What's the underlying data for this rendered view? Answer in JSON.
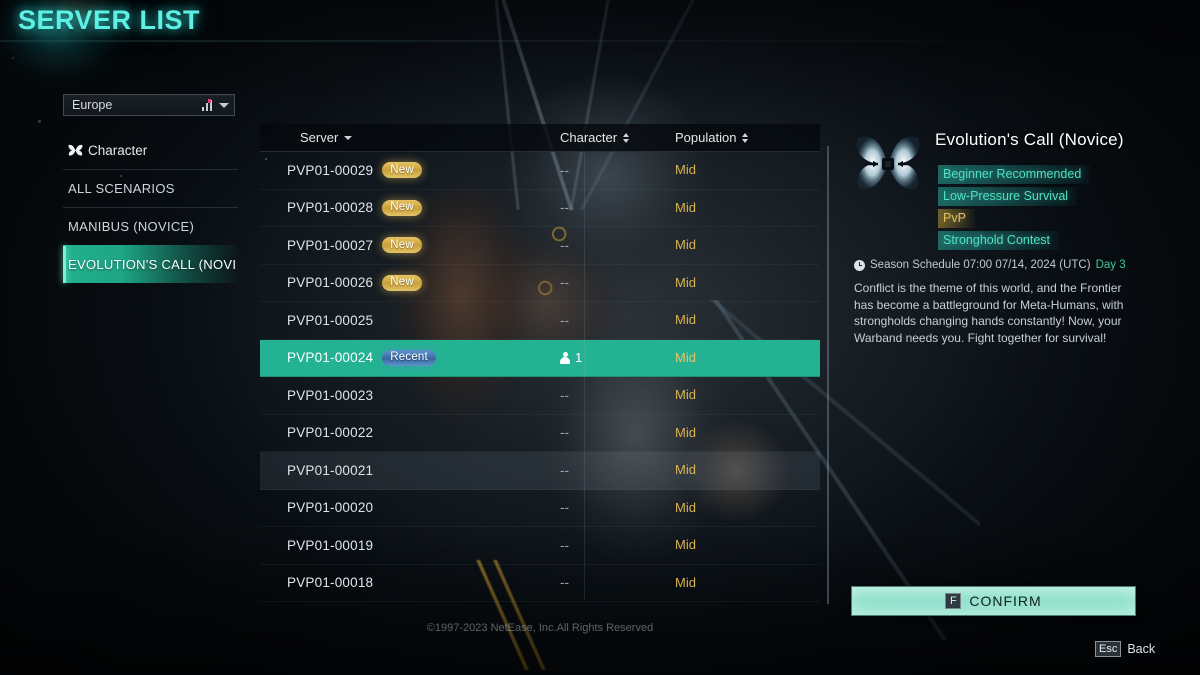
{
  "page_title": "SERVER LIST",
  "region_select": {
    "name": "region-dropdown",
    "value": "Europe",
    "signal_icon": "signal-bars-icon",
    "chevron_icon": "chevron-down-icon"
  },
  "sidebar": {
    "items": [
      {
        "label": "Character",
        "icon": "moth-emblem-icon",
        "selected": false,
        "has_icon": true
      },
      {
        "label": "ALL SCENARIOS",
        "selected": false,
        "has_icon": false
      },
      {
        "label": "MANIBUS (NOVICE)",
        "selected": false,
        "has_icon": false
      },
      {
        "label": "EVOLUTION'S CALL (NOVI",
        "selected": true,
        "has_icon": false
      }
    ]
  },
  "table": {
    "headers": {
      "server": "Server",
      "character": "Character",
      "population": "Population",
      "server_sort_icon": "chevron-down-icon",
      "character_sort_icon": "sort-updown-icon",
      "population_sort_icon": "sort-updown-icon"
    },
    "rows": [
      {
        "server": "PVP01-00029",
        "badge": "New",
        "badge_type": "new",
        "character": "--",
        "population": "Mid",
        "state": "normal"
      },
      {
        "server": "PVP01-00028",
        "badge": "New",
        "badge_type": "new",
        "character": "--",
        "population": "Mid",
        "state": "normal"
      },
      {
        "server": "PVP01-00027",
        "badge": "New",
        "badge_type": "new",
        "character": "--",
        "population": "Mid",
        "state": "normal"
      },
      {
        "server": "PVP01-00026",
        "badge": "New",
        "badge_type": "new",
        "character": "--",
        "population": "Mid",
        "state": "normal"
      },
      {
        "server": "PVP01-00025",
        "badge": "",
        "badge_type": "",
        "character": "--",
        "population": "Mid",
        "state": "normal"
      },
      {
        "server": "PVP01-00024",
        "badge": "Recent",
        "badge_type": "recent",
        "character": "1",
        "population": "Mid",
        "state": "selected"
      },
      {
        "server": "PVP01-00023",
        "badge": "",
        "badge_type": "",
        "character": "--",
        "population": "Mid",
        "state": "normal"
      },
      {
        "server": "PVP01-00022",
        "badge": "",
        "badge_type": "",
        "character": "--",
        "population": "Mid",
        "state": "normal"
      },
      {
        "server": "PVP01-00021",
        "badge": "",
        "badge_type": "",
        "character": "--",
        "population": "Mid",
        "state": "hovered"
      },
      {
        "server": "PVP01-00020",
        "badge": "",
        "badge_type": "",
        "character": "--",
        "population": "Mid",
        "state": "normal"
      },
      {
        "server": "PVP01-00019",
        "badge": "",
        "badge_type": "",
        "character": "--",
        "population": "Mid",
        "state": "normal"
      },
      {
        "server": "PVP01-00018",
        "badge": "",
        "badge_type": "",
        "character": "--",
        "population": "Mid",
        "state": "normal"
      }
    ]
  },
  "copyright": "©1997-2023 NetEase, Inc.All Rights Reserved",
  "detail": {
    "emblem_icon": "moth-emblem-icon",
    "title": "Evolution's Call (Novice)",
    "tags": [
      {
        "label": "Beginner Recommended",
        "color": "teal"
      },
      {
        "label": "Low-Pressure Survival",
        "color": "teal"
      },
      {
        "label": "PvP",
        "color": "gold"
      },
      {
        "label": "Stronghold Contest",
        "color": "teal"
      }
    ],
    "schedule_icon": "clock-icon",
    "schedule_label": "Season Schedule 07:00 07/14, 2024 (UTC)",
    "schedule_day": "Day 3",
    "description": "Conflict is the theme of this world, and the Frontier has become a battleground for Meta-Humans, with strongholds changing hands constantly! Now, your Warband needs you. Fight together for survival!"
  },
  "confirm_button": {
    "key": "F",
    "label": "CONFIRM"
  },
  "footer_back": {
    "key": "Esc",
    "label": "Back"
  },
  "colors": {
    "accent_teal": "#23b392",
    "title_cyan": "#5df1e6",
    "badge_new_gold": "#c9a03a",
    "badge_recent_blue": "#39689f",
    "population_gold": "#d8b351",
    "confirm_green": "#9ce6d3"
  }
}
